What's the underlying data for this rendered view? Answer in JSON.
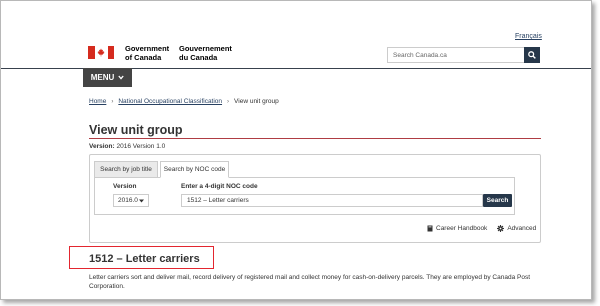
{
  "header": {
    "language_link": "Français",
    "gov_en_line1": "Government",
    "gov_en_line2": "of Canada",
    "gov_fr_line1": "Gouvernement",
    "gov_fr_line2": "du Canada",
    "search_placeholder": "Search Canada.ca",
    "search_icon": "magnifier-icon",
    "flag_colors": {
      "red": "#d52b1e",
      "white": "#ffffff"
    }
  },
  "menu": {
    "label": "MENU",
    "icon": "chevron-down-icon"
  },
  "breadcrumb": {
    "items": [
      "Home",
      "National Occupational Classification",
      "View unit group"
    ],
    "separator": "›"
  },
  "page": {
    "title": "View unit group",
    "version_label": "Version:",
    "version_value": "2016 Version 1.0"
  },
  "tabs": [
    {
      "label": "Search by job title",
      "active": false
    },
    {
      "label": "Search by NOC code",
      "active": true
    }
  ],
  "form": {
    "version_label": "Version",
    "version_selected": "2016.0",
    "noc_label": "Enter a 4-digit NOC code",
    "noc_value": "1512 – Letter carriers",
    "search_button": "Search"
  },
  "links": {
    "career_handbook": "Career Handbook",
    "advanced": "Advanced"
  },
  "result": {
    "title": "1512 – Letter carriers",
    "description": "Letter carriers sort and deliver mail, record delivery of registered mail and collect money for cash-on-delivery parcels. They are employed by Canada Post Corporation."
  },
  "colors": {
    "brand_dark": "#26374a",
    "menu_bg": "#444444",
    "accent_red": "#af3c43",
    "highlight_red": "#e3262f",
    "link": "#284162"
  }
}
